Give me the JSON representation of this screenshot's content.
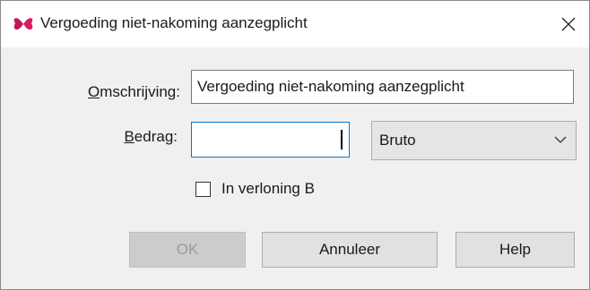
{
  "dialog": {
    "title": "Vergoeding niet-nakoming aanzegplicht",
    "app_icon": "butterfly-logo-icon",
    "close_icon": "close-icon",
    "accent_color": "#0078d7",
    "icon_color": "#c2185b"
  },
  "form": {
    "omschrijving_label_accel": "O",
    "omschrijving_label_rest": "mschrijving:",
    "omschrijving_value": "Vergoeding niet-nakoming aanzegplicht",
    "bedrag_label_accel": "B",
    "bedrag_label_rest": "edrag:",
    "bedrag_value": "",
    "bedrag_type_selected": "Bruto",
    "verloning_label": "In verloning B",
    "verloning_checked": false
  },
  "buttons": {
    "ok": "OK",
    "cancel": "Annuleer",
    "help": "Help"
  }
}
